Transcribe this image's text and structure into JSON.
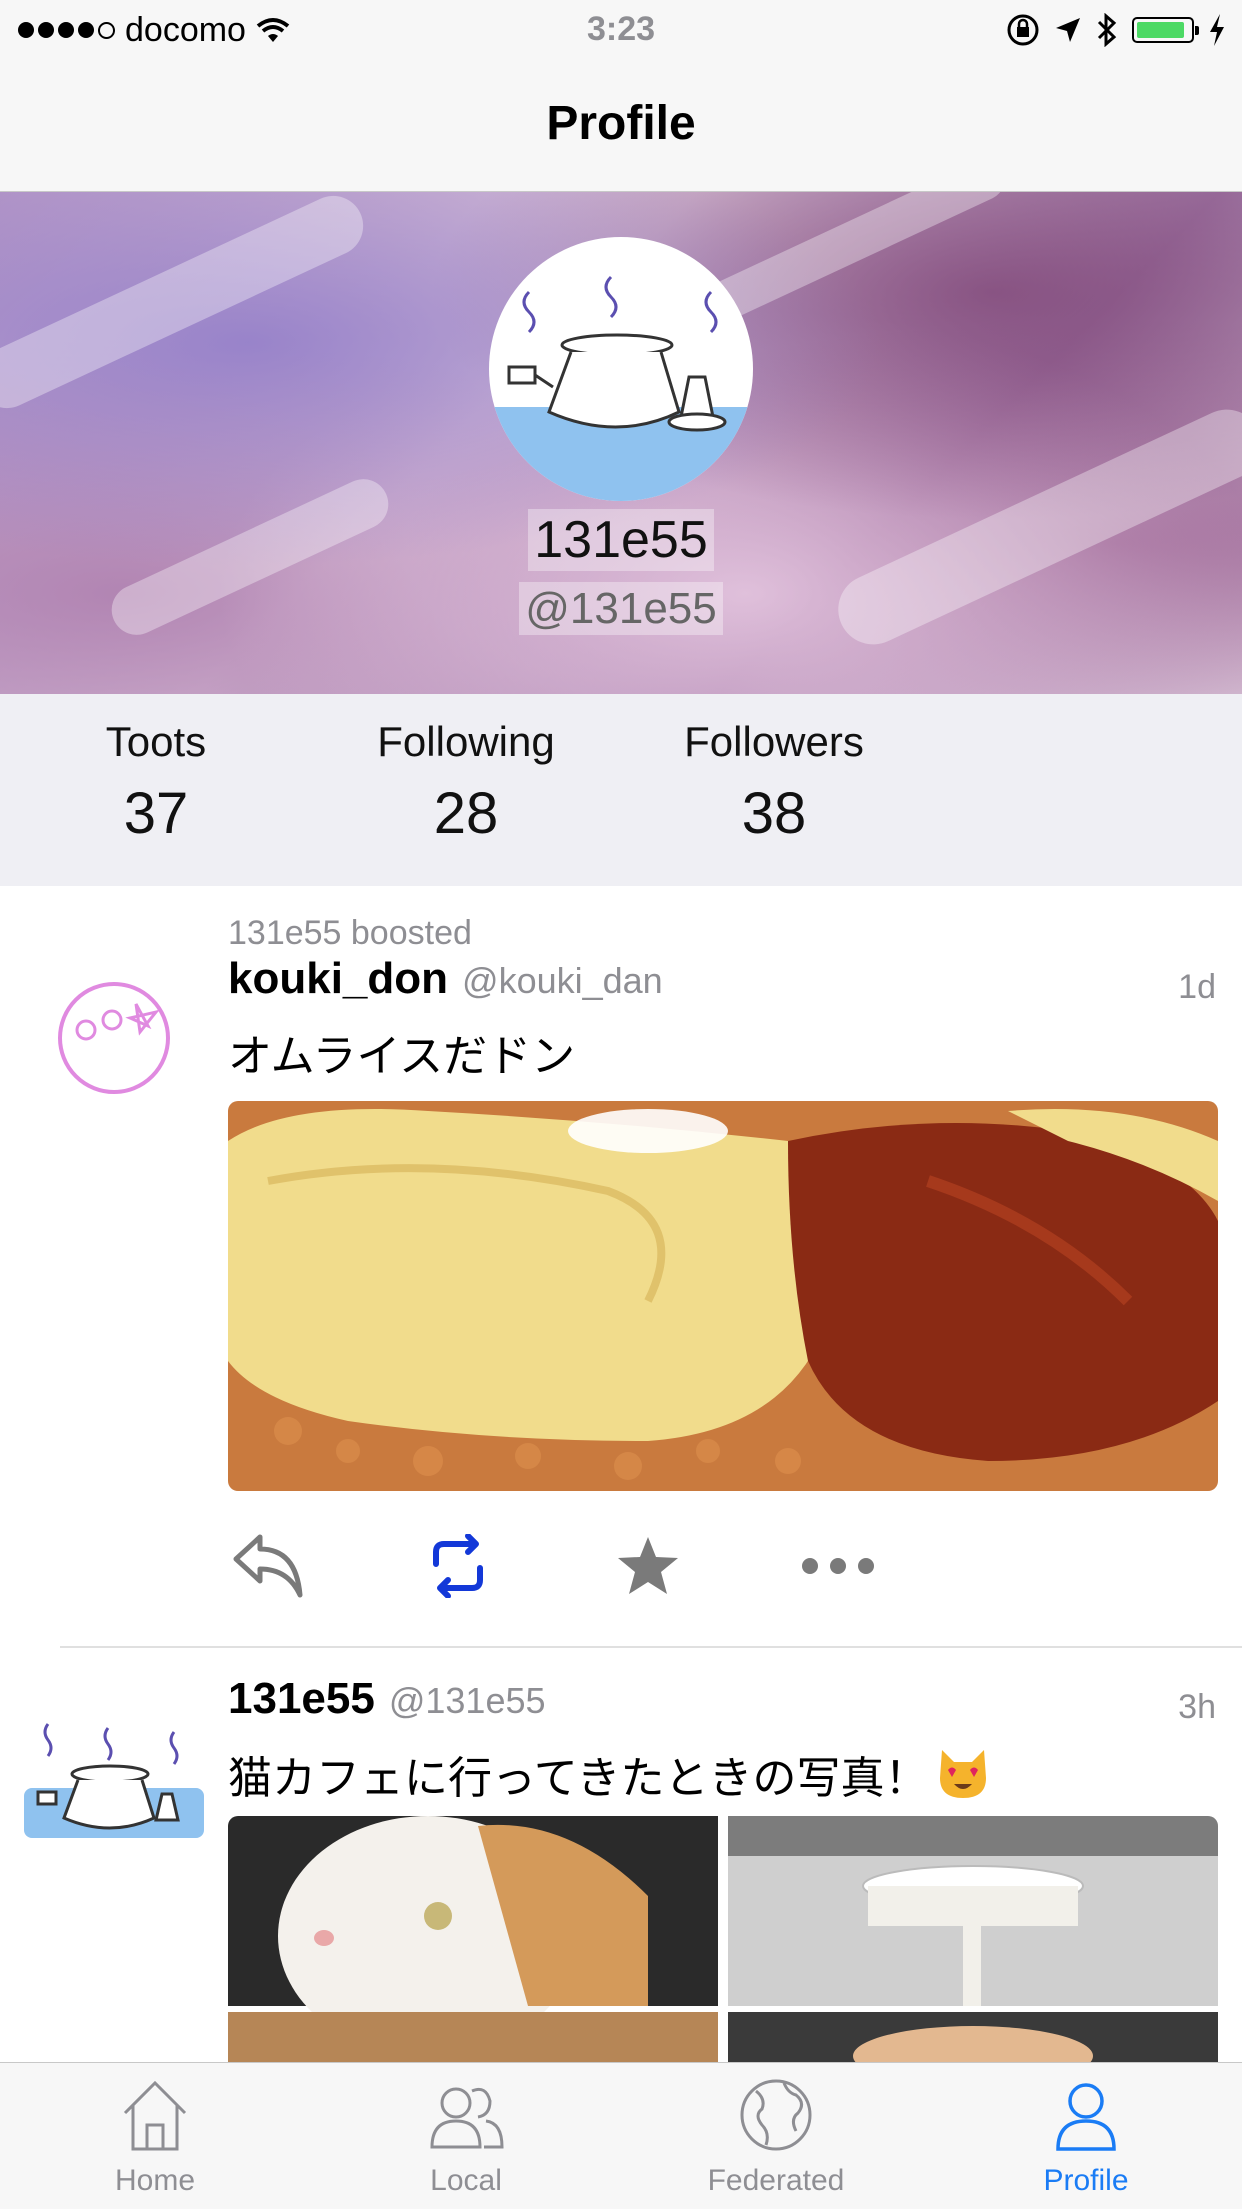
{
  "status_bar": {
    "carrier": "docomo",
    "time": "3:23",
    "battery_level": 0.9,
    "battery_color": "#4cd964"
  },
  "nav": {
    "title": "Profile"
  },
  "profile": {
    "display_name": "131e55",
    "handle": "@131e55"
  },
  "stats": [
    {
      "label": "Toots",
      "value": "37"
    },
    {
      "label": "Following",
      "value": "28"
    },
    {
      "label": "Followers",
      "value": "38"
    }
  ],
  "posts": [
    {
      "boosted_by": "131e55 boosted",
      "name": "kouki_don",
      "acct": "@kouki_dan",
      "time": "1d",
      "content": "オムライスだドン",
      "reblogged": true
    },
    {
      "name": "131e55",
      "acct": "@131e55",
      "time": "3h",
      "content": "猫カフェに行ってきたときの写真！"
    }
  ],
  "tabs": [
    {
      "label": "Home",
      "icon": "house-icon"
    },
    {
      "label": "Local",
      "icon": "people-icon"
    },
    {
      "label": "Federated",
      "icon": "globe-icon"
    },
    {
      "label": "Profile",
      "icon": "person-icon",
      "active": true
    }
  ],
  "colors": {
    "accent": "#1a7cf5",
    "boost_active": "#1338d8",
    "muted": "#8e8e93"
  }
}
